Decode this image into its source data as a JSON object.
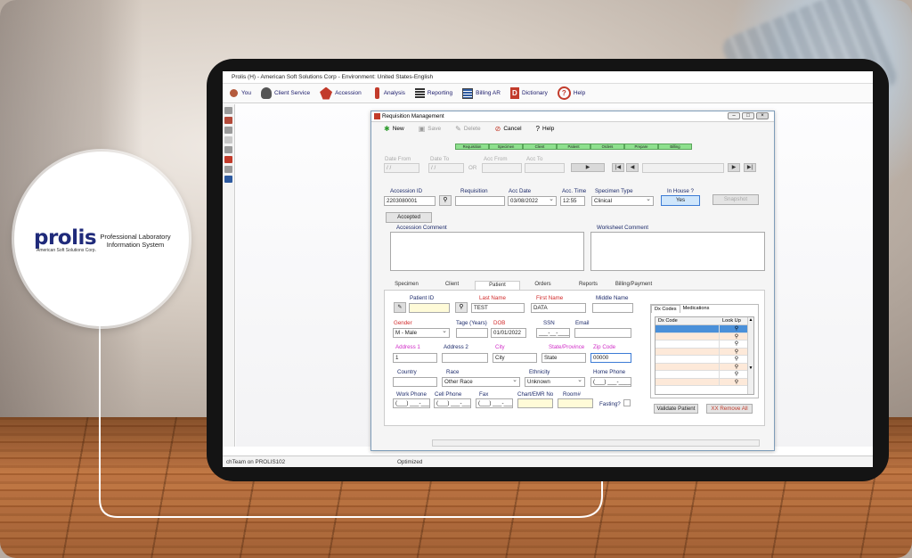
{
  "app": {
    "title": "Prolis (H) - American Soft Solutions Corp - Environment: United States-English",
    "menu": [
      {
        "label": "You",
        "icon": "user-icon"
      },
      {
        "label": "Client Service",
        "icon": "client-service-icon"
      },
      {
        "label": "Accession",
        "icon": "accession-icon"
      },
      {
        "label": "Analysis",
        "icon": "analysis-icon"
      },
      {
        "label": "Reporting",
        "icon": "reporting-icon"
      },
      {
        "label": "Billing AR",
        "icon": "billing-icon"
      },
      {
        "label": "Dictionary",
        "icon": "dictionary-icon"
      },
      {
        "label": "Help",
        "icon": "help-icon"
      }
    ],
    "status": {
      "left": "chTeam on PROLIS102",
      "mid": "Optimized"
    }
  },
  "window": {
    "title": "Requisition Management",
    "toolbar": {
      "new": "New",
      "save": "Save",
      "delete": "Delete",
      "cancel": "Cancel",
      "help": "Help"
    },
    "steps": [
      "Requisition",
      "Specimen",
      "Client",
      "Patient",
      "Orders",
      "Prepare",
      "Billing"
    ],
    "filter": {
      "date_from": "Date From",
      "date_to": "Date To",
      "date_from_value": "/ /",
      "date_to_value": "/ /",
      "or": "OR",
      "acc_from": "Acc From",
      "acc_to": "Acc To"
    },
    "accession": {
      "accession_id_label": "Accession ID",
      "accession_id": "2203080001",
      "requisition_label": "Requisition",
      "requisition": "",
      "acc_date_label": "Acc Date",
      "acc_date": "03/08/2022",
      "acc_time_label": "Acc. Time",
      "acc_time": "12:55",
      "specimen_type_label": "Specimen Type",
      "specimen_type": "Clinical",
      "in_house_label": "In House ?",
      "in_house": "Yes",
      "status_button": "Accepted",
      "disabled_button": "Snapshot",
      "accession_comment_label": "Accession Comment",
      "worksheet_comment_label": "Worksheet Comment"
    },
    "tabs": [
      "Specimen",
      "Client",
      "Patient",
      "Orders",
      "Reports",
      "Billing/Payment"
    ],
    "active_tab": "Patient",
    "patient": {
      "patient_id_label": "Patient ID",
      "patient_id": "",
      "last_name_label": "Last Name",
      "last_name": "TEST",
      "first_name_label": "First Name",
      "first_name": "DATA",
      "middle_name_label": "Middle Name",
      "middle_name": "",
      "gender_label": "Gender",
      "gender": "M - Male",
      "age_label": "Tage (Years)",
      "age": "",
      "dob_label": "DOB",
      "dob": "01/01/2022",
      "ssn_label": "SSN",
      "ssn": "___-__-____",
      "email_label": "Email",
      "email": "",
      "address1_label": "Address 1",
      "address1": "1",
      "address2_label": "Address 2",
      "address2": "",
      "city_label": "City",
      "city": "City",
      "state_label": "State/Province",
      "state": "State",
      "zip_label": "Zip Code",
      "zip": "00000",
      "country_label": "Country",
      "country": "",
      "race_label": "Race",
      "race": "Other Race",
      "ethnicity_label": "Ethnicity",
      "ethnicity": "Unknown",
      "home_phone_label": "Home Phone",
      "home_phone": "(___) ___-____",
      "work_phone_label": "Work Phone",
      "work_phone": "(___) ___-____",
      "cell_phone_label": "Cell Phone",
      "cell_phone": "(___) ___-____",
      "fax_label": "Fax",
      "fax": "(___) ___-____",
      "chart_label": "Chart/EMR No",
      "chart": "",
      "room_label": "Room#",
      "room": "",
      "fasting_label": "Fasting?",
      "validate_button": "Validate Patient",
      "remove_button": "XX Remove All"
    },
    "dx": {
      "tabs": [
        "Dx Codes",
        "Medications"
      ],
      "headers": [
        "Dx Code",
        "Look Up"
      ]
    }
  },
  "logo": {
    "wordmark": "prolis",
    "sub": "American Soft Solutions Corp.",
    "tagline": "Professional Laboratory Information System",
    "colors": {
      "brand_blue": "#1f2a7a",
      "brand_red": "#d32027"
    }
  }
}
